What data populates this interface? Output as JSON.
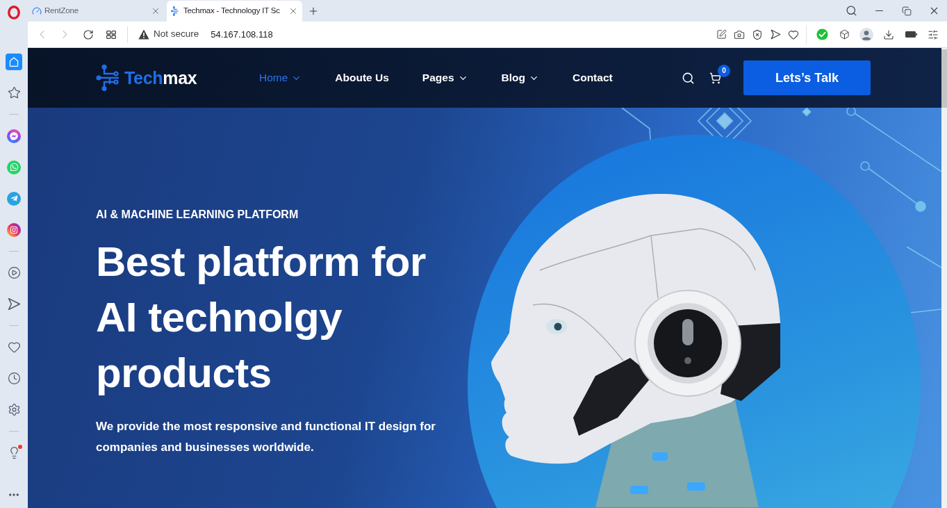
{
  "browser": {
    "tabs": [
      {
        "title": "RentZone",
        "selected": false
      },
      {
        "title": "Techmax - Technology IT Sc",
        "selected": true
      }
    ],
    "address_bar": {
      "back": {
        "disabled": true
      },
      "forward": {
        "disabled": true
      },
      "security": "Not secure",
      "url": "54.167.108.118"
    },
    "sidebar": {
      "groups": [
        {
          "items": [
            {
              "selected": true,
              "notification": false
            },
            {
              "selected": false,
              "notification": false
            }
          ]
        },
        {
          "items": [
            {
              "selected": false,
              "notification": false
            },
            {
              "selected": false,
              "notification": false
            },
            {
              "selected": false,
              "notification": false
            },
            {
              "selected": false,
              "notification": false
            }
          ]
        },
        {
          "items": [
            {
              "selected": false,
              "notification": false
            },
            {
              "selected": false,
              "notification": false
            }
          ]
        },
        {
          "items": [
            {
              "selected": false,
              "notification": false
            },
            {
              "selected": false,
              "notification": false
            },
            {
              "selected": false,
              "notification": false
            }
          ]
        },
        {
          "items": [
            {
              "selected": false,
              "notification": true
            }
          ]
        }
      ]
    }
  },
  "site": {
    "logo": {
      "primary": "Tech",
      "secondary": "max"
    },
    "nav": [
      {
        "label": "Home",
        "selected": true,
        "dropdown": true
      },
      {
        "label": "Aboute Us",
        "selected": false,
        "dropdown": false
      },
      {
        "label": "Pages",
        "selected": false,
        "dropdown": true
      },
      {
        "label": "Blog",
        "selected": false,
        "dropdown": true
      },
      {
        "label": "Contact",
        "selected": false,
        "dropdown": false
      }
    ],
    "cart_count": "0",
    "cta": "Lets’s Talk"
  },
  "hero": {
    "eyebrow": "AI & MACHINE LEARNING PLATFORM",
    "headline": "Best platform for AI technolgy products",
    "description": "We provide the most responsive and functional IT design for companies and businesses worldwide."
  }
}
